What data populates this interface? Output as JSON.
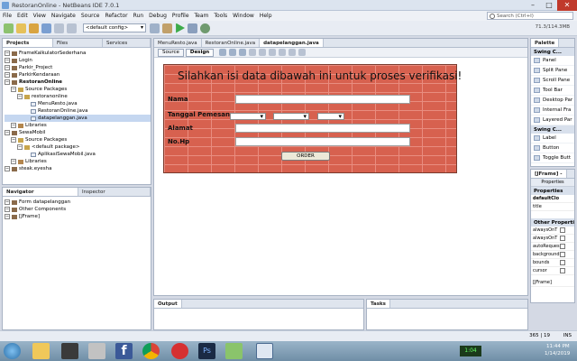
{
  "window": {
    "title": "RestoranOnline - NetBeans IDE 7.0.1"
  },
  "menu": [
    "File",
    "Edit",
    "View",
    "Navigate",
    "Source",
    "Refactor",
    "Run",
    "Debug",
    "Profile",
    "Team",
    "Tools",
    "Window",
    "Help"
  ],
  "search": {
    "placeholder": "Search (Ctrl+I)"
  },
  "toolbar": {
    "config": "<default config>",
    "memory": "71.3/114.3MB"
  },
  "projects": {
    "tabs": [
      "Projects",
      "Files",
      "Services"
    ],
    "tree": [
      {
        "label": "FrameKalkulatorSederhana",
        "depth": 0,
        "icon": "proj"
      },
      {
        "label": "Login",
        "depth": 0,
        "icon": "proj"
      },
      {
        "label": "Parkir_Project",
        "depth": 0,
        "icon": "proj"
      },
      {
        "label": "ParkirKendaraan",
        "depth": 0,
        "icon": "proj"
      },
      {
        "label": "RestoranOnline",
        "depth": 0,
        "icon": "proj",
        "bold": true
      },
      {
        "label": "Source Packages",
        "depth": 1,
        "icon": "pkg"
      },
      {
        "label": "restoranonline",
        "depth": 2,
        "icon": "pkg"
      },
      {
        "label": "MenuResto.java",
        "depth": 3,
        "icon": "file"
      },
      {
        "label": "RestoranOnline.java",
        "depth": 3,
        "icon": "file"
      },
      {
        "label": "datapelanggan.java",
        "depth": 3,
        "icon": "file",
        "selected": true
      },
      {
        "label": "Libraries",
        "depth": 1,
        "icon": "lib"
      },
      {
        "label": "SewaMobil",
        "depth": 0,
        "icon": "proj"
      },
      {
        "label": "Source Packages",
        "depth": 1,
        "icon": "pkg"
      },
      {
        "label": "<default package>",
        "depth": 2,
        "icon": "pkg"
      },
      {
        "label": "AplikasiSewaMobil.java",
        "depth": 3,
        "icon": "file"
      },
      {
        "label": "Libraries",
        "depth": 1,
        "icon": "lib"
      },
      {
        "label": "steak.eyesha",
        "depth": 0,
        "icon": "proj"
      }
    ]
  },
  "navigator": {
    "tabs": [
      "Navigator",
      "Inspector"
    ],
    "tree": [
      {
        "label": "Form datapelanggan",
        "depth": 0
      },
      {
        "label": "Other Components",
        "depth": 0
      },
      {
        "label": "[JFrame]",
        "depth": 0
      }
    ]
  },
  "editor": {
    "tabs": [
      "MenuResto.java",
      "RestoranOnline.java",
      "datapelanggan.java"
    ],
    "modes": [
      "Source",
      "Design"
    ]
  },
  "form": {
    "title": "Silahkan isi data dibawah ini untuk proses verifikasi!",
    "labels": {
      "nama": "Nama",
      "tanggal": "Tanggal Pemesanan",
      "alamat": "Alamat",
      "nohp": "No.Hp"
    },
    "button": "ORDER"
  },
  "palette": {
    "title": "Palette",
    "section1": "Swing C...",
    "items1": [
      "Panel",
      "Split Pane",
      "Scroll Pane",
      "Tool Bar",
      "Desktop Par",
      "Internal Fra",
      "Layered Par"
    ],
    "section2": "Swing C...",
    "items2": [
      "Label",
      "Button",
      "Toggle Butt"
    ]
  },
  "properties": {
    "title": "[JFrame] -",
    "tab": "Properties",
    "header1": "Properties",
    "row1": "defaultClo",
    "row2": "title",
    "header2": "Other Properti",
    "rows": [
      "alwaysOnT",
      "alwaysOnT",
      "autoReques",
      "background",
      "bounds",
      "cursor"
    ],
    "footer": "[JFrame]"
  },
  "output": {
    "title": "Output",
    "tasks": "Tasks"
  },
  "status": {
    "pos": "365 | 19",
    "mode": "INS"
  },
  "clock": {
    "time": "11:44 PM",
    "date": "1/14/2019",
    "indicator": "1:04"
  },
  "colors": {
    "brick": "#d7614f",
    "ide_bg": "#d4d9e4",
    "accent": "#6fa0d8"
  }
}
